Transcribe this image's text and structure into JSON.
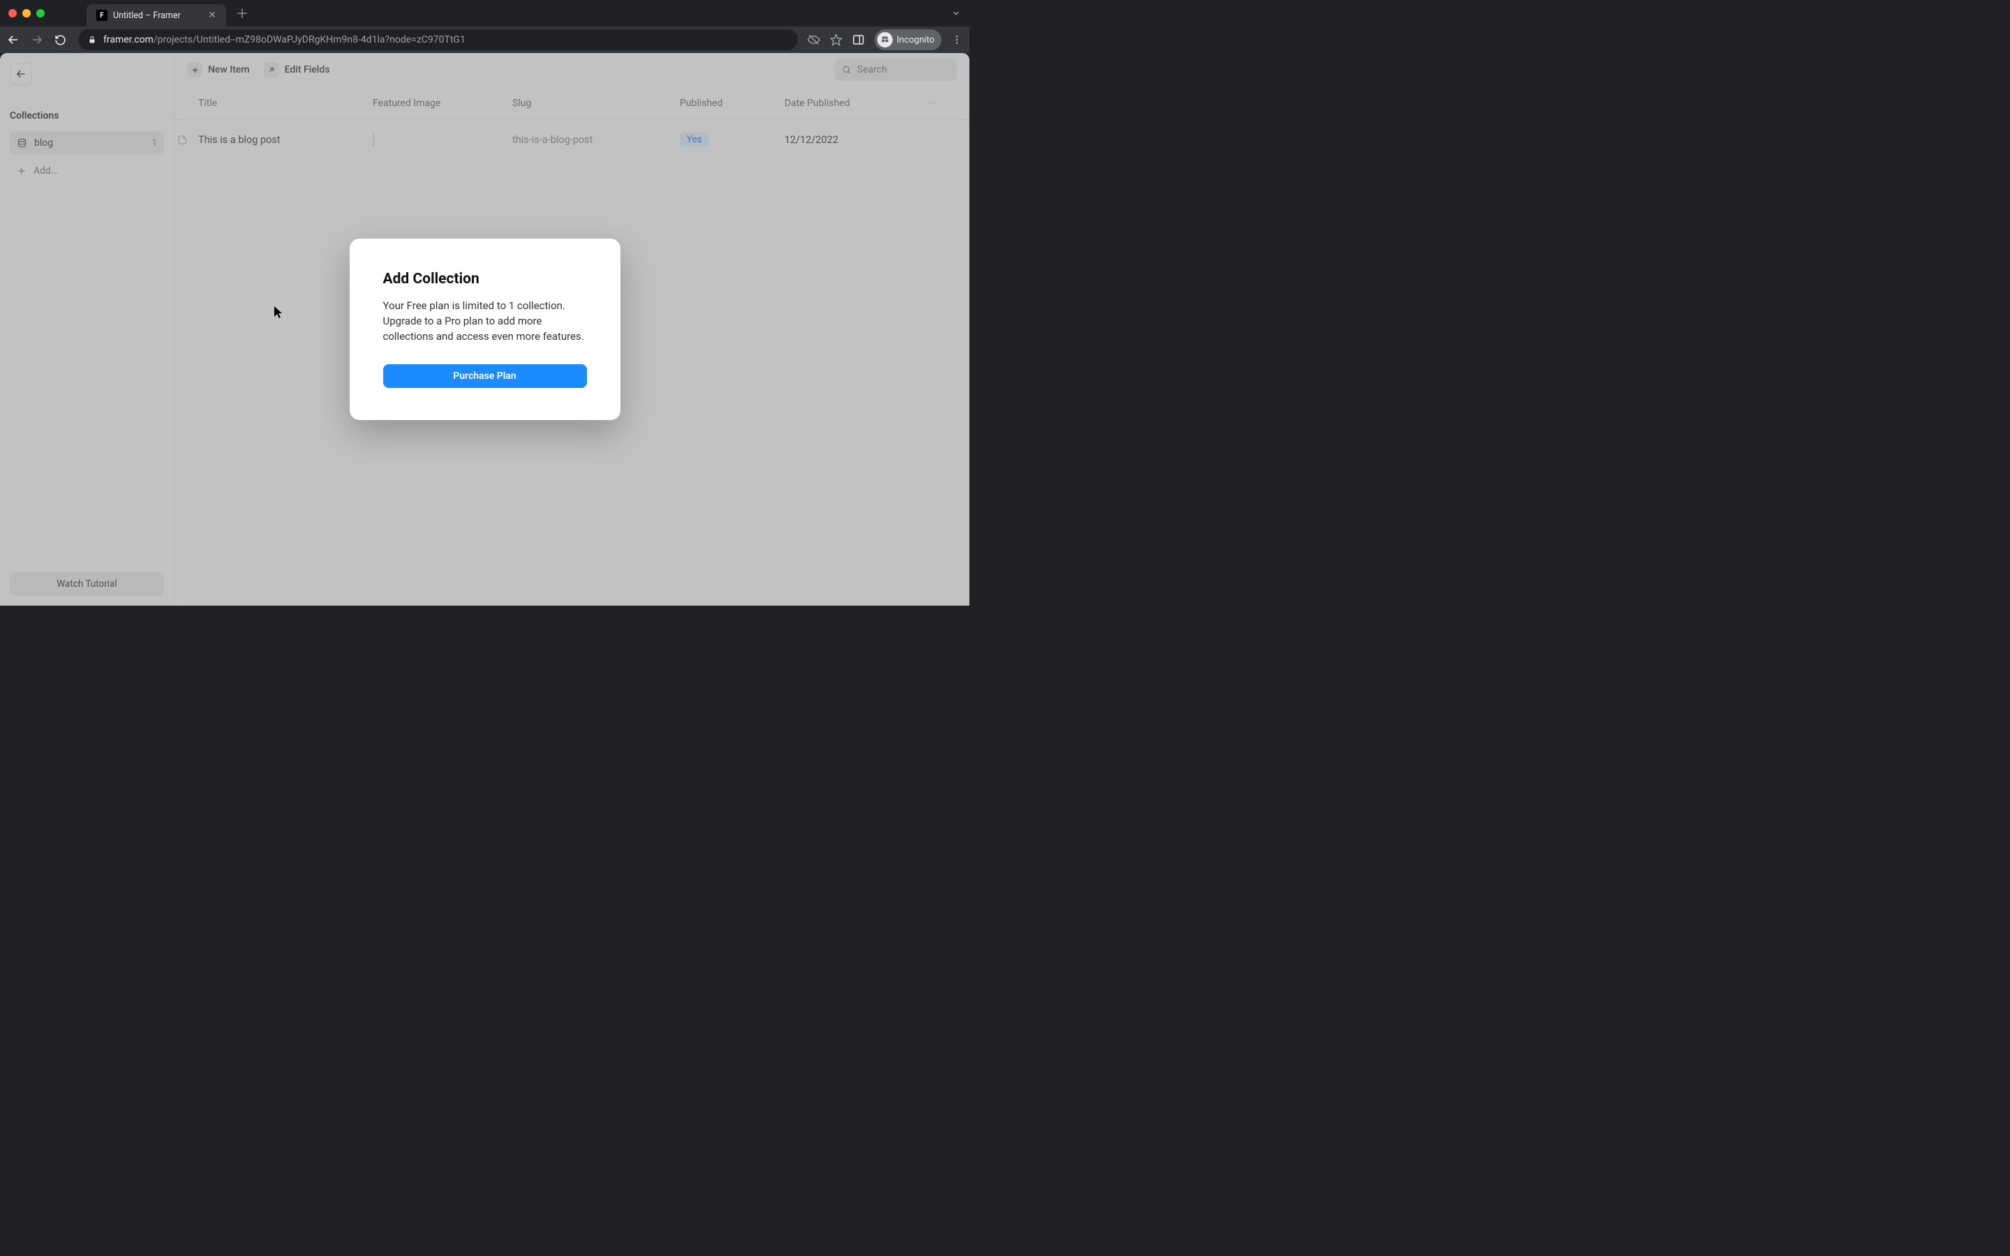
{
  "browser": {
    "tab_title": "Untitled – Framer",
    "url_host": "framer.com",
    "url_path": "/projects/Untitled--mZ98oDWaPJyDRgKHm9n8-4d1la?node=zC970TtG1",
    "incognito_label": "Incognito"
  },
  "sidebar": {
    "back_label": "Back",
    "section_label": "Collections",
    "items": [
      {
        "name": "blog",
        "count": "1"
      }
    ],
    "add_label": "Add...",
    "watch_label": "Watch Tutorial"
  },
  "toolbar": {
    "new_item": "New Item",
    "edit_fields": "Edit Fields",
    "search_placeholder": "Search"
  },
  "table": {
    "headers": {
      "title": "Title",
      "featured_image": "Featured Image",
      "slug": "Slug",
      "published": "Published",
      "date_published": "Date Published"
    },
    "rows": [
      {
        "title": "This is a blog post",
        "slug": "this-is-a-blog-post",
        "published": "Yes",
        "date": "12/12/2022"
      }
    ],
    "more_label": "···"
  },
  "modal": {
    "title": "Add Collection",
    "body": "Your Free plan is limited to 1 collection. Upgrade to a Pro plan to add more collections and access even more features.",
    "cta": "Purchase Plan"
  }
}
